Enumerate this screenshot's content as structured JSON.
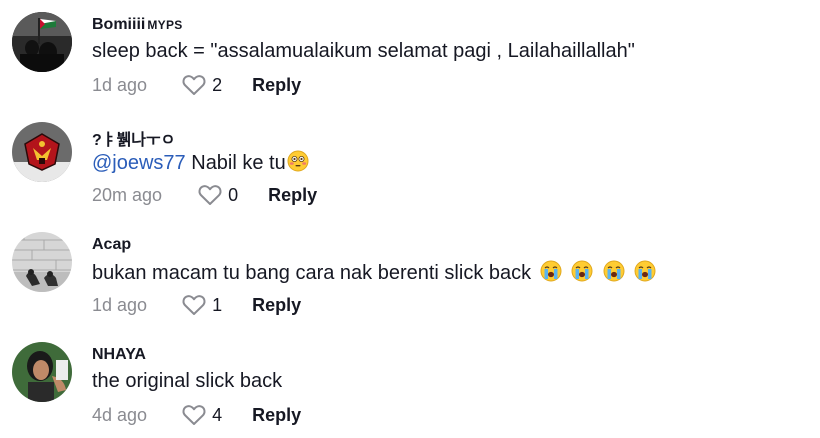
{
  "comments": [
    {
      "username": "Bomiiii",
      "user_tag": "MYPS",
      "text": "sleep back = \"assalamualaikum selamat pagi , Lailahaillallah\"",
      "time": "1d ago",
      "likes": "2",
      "reply_label": "Reply"
    },
    {
      "username": "?ㅑ뷁나ㅜㅇ",
      "mention": "@joews77",
      "text": " Nabil ke tu",
      "emoji": "flushed-face",
      "time": "20m ago",
      "likes": "0",
      "reply_label": "Reply"
    },
    {
      "username": "Acap",
      "text": "bukan macam tu bang cara nak berenti slick back",
      "emoji": "loudly-crying-face",
      "emoji_count": 4,
      "time": "1d ago",
      "likes": "1",
      "reply_label": "Reply"
    },
    {
      "username": "NHAYA",
      "text": "the original slick back",
      "time": "4d ago",
      "likes": "4",
      "reply_label": "Reply"
    }
  ],
  "icons": {
    "like": "heart-outline-icon"
  },
  "colors": {
    "text": "#161823",
    "muted": "#8a8b91",
    "mention": "#2b5db9"
  }
}
